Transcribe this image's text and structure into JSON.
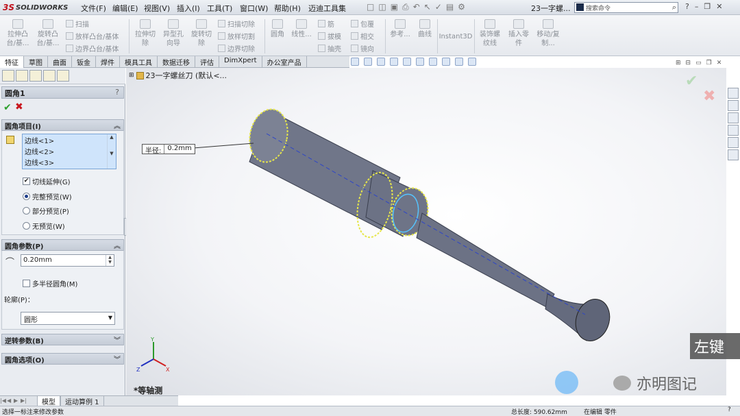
{
  "app": {
    "logo_ds": "3S",
    "logo_text": "SOLIDWORKS"
  },
  "menu": [
    "文件(F)",
    "编辑(E)",
    "视图(V)",
    "插入(I)",
    "工具(T)",
    "窗口(W)",
    "帮助(H)",
    "迈迪工具集"
  ],
  "title": {
    "document": "23一字螺...",
    "search_placeholder": "搜索命令"
  },
  "commands": {
    "extrude_boss": "拉伸凸台/基...",
    "revolve_boss": "旋转凸台/基...",
    "sweep": "扫描",
    "loft_boss": "放样凸台/基体",
    "boundary_boss": "边界凸台/基体",
    "extrude_cut": "拉伸切除",
    "hole_wizard": "异型孔向导",
    "revolve_cut": "旋转切除",
    "sweep_cut": "扫描切除",
    "loft_cut": "放样切割",
    "boundary_cut": "边界切除",
    "fillet": "圆角",
    "linear_pattern": "线性...",
    "rib": "筋",
    "draft": "拔模",
    "shell": "抽壳",
    "wrap": "包覆",
    "intersect": "相交",
    "mirror": "镜向",
    "reference": "参考...",
    "curves": "曲线",
    "instant3d": "Instant3D",
    "cosmetic_thread": "装饰螺纹线",
    "insert_part": "插入零件",
    "move_copy": "移动/复制..."
  },
  "tabs": [
    "特征",
    "草图",
    "曲面",
    "钣金",
    "焊件",
    "模具工具",
    "数据迁移",
    "评估",
    "DimXpert",
    "办公室产品"
  ],
  "panel": {
    "title": "圆角1",
    "help": "?",
    "group_items": "圆角项目(I)",
    "edges": [
      "边线<1>",
      "边线<2>",
      "边线<3>"
    ],
    "tangent_propagation": "切线延伸(G)",
    "preview_full": "完整预览(W)",
    "preview_partial": "部分预览(P)",
    "preview_none": "无预览(W)",
    "group_params": "圆角参数(P)",
    "radius_value": "0.20mm",
    "multi_radius": "多半径圆角(M)",
    "profile_label": "轮廓(P)：",
    "profile_value": "圆形",
    "group_setback": "逆转参数(B)",
    "group_options": "圆角选项(O)"
  },
  "viewport": {
    "tree_root": "23一字螺丝刀 (默认<...",
    "radius_callout_label": "半径:",
    "radius_callout_value": "0.2mm",
    "view_name": "*等轴测",
    "mouse_hint": "左键",
    "watermark": "亦明图记"
  },
  "bottom_tabs": [
    "模型",
    "运动算例 1"
  ],
  "status": {
    "message": "选择一标注来修改参数",
    "total_length": "总长度: 590.62mm",
    "mode": "在编辑 零件"
  }
}
